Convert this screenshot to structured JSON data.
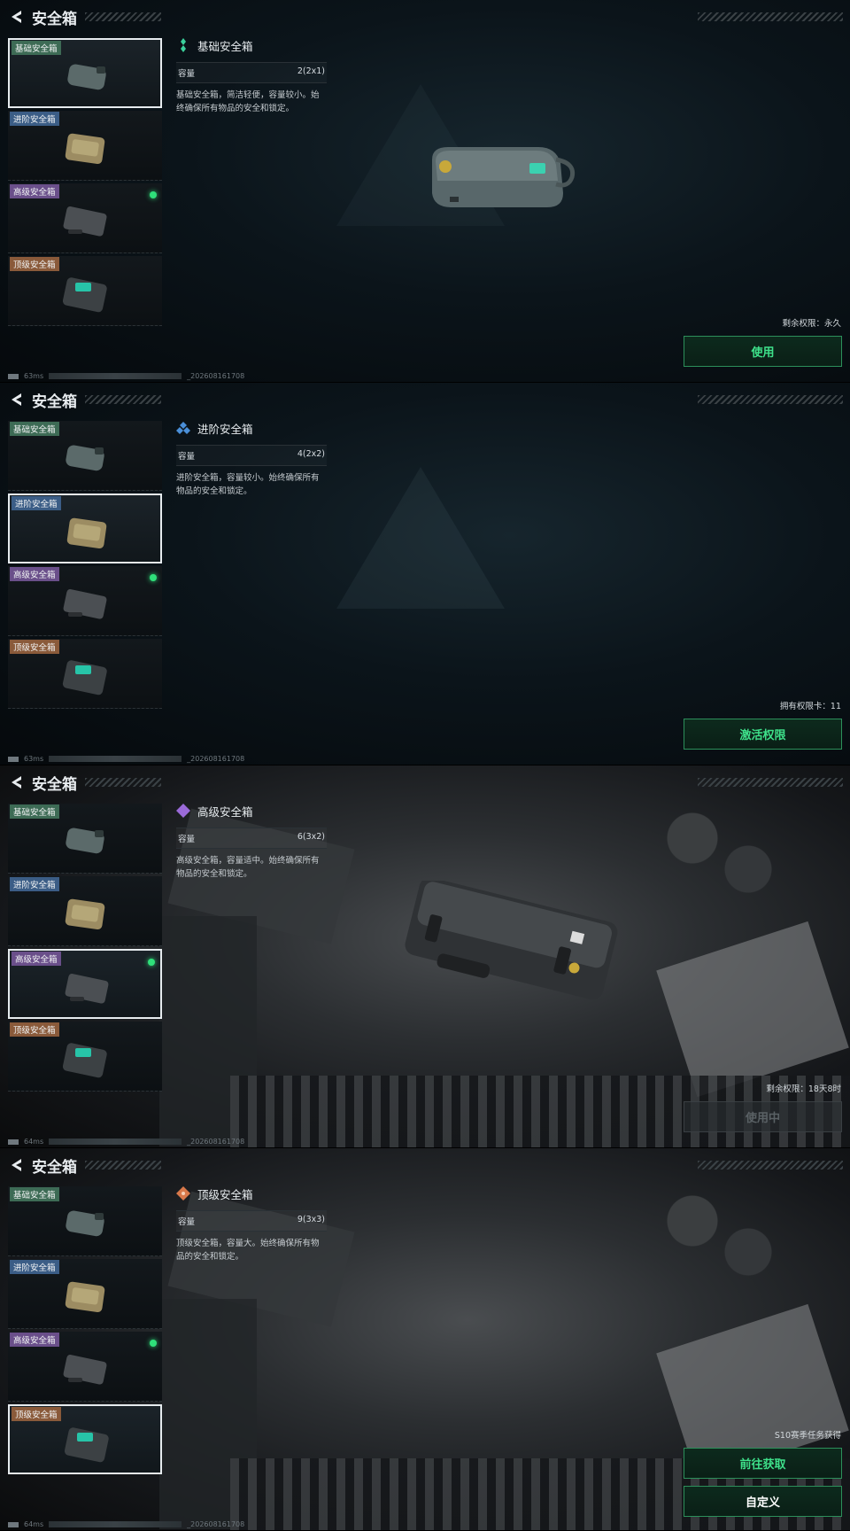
{
  "app_title": "安全箱",
  "boxes": [
    {
      "tag": "基础安全箱",
      "tag_color": "#3d6b55"
    },
    {
      "tag": "进阶安全箱",
      "tag_color": "#3b5d86"
    },
    {
      "tag": "高级安全箱",
      "tag_color": "#6a4f8a"
    },
    {
      "tag": "顶级安全箱",
      "tag_color": "#8a5a3a"
    }
  ],
  "screens": [
    {
      "name": "基础安全箱",
      "gem_color": "#3bd19c",
      "capacity_label": "容量",
      "capacity_value": "2(2x1)",
      "desc": "基础安全箱，简洁轻便，容量较小。始终确保所有物品的安全和锁定。",
      "status": "剩余权限：永久",
      "primary_button": "使用",
      "ping": "63ms",
      "build": "_202608161708"
    },
    {
      "name": "进阶安全箱",
      "gem_color": "#4a8fd8",
      "capacity_label": "容量",
      "capacity_value": "4(2x2)",
      "desc": "进阶安全箱，容量较小。始终确保所有物品的安全和锁定。",
      "status": "拥有权限卡：11",
      "primary_button": "激活权限",
      "ping": "63ms",
      "build": "_202608161708"
    },
    {
      "name": "高级安全箱",
      "gem_color": "#9a6ad8",
      "capacity_label": "容量",
      "capacity_value": "6(3x2)",
      "desc": "高级安全箱，容量适中。始终确保所有物品的安全和锁定。",
      "status": "剩余权限：18天8时",
      "primary_button": "使用中",
      "ping": "64ms",
      "build": "_202608161708"
    },
    {
      "name": "顶级安全箱",
      "gem_color": "#d8784a",
      "capacity_label": "容量",
      "capacity_value": "9(3x3)",
      "desc": "顶级安全箱，容量大。始终确保所有物品的安全和锁定。",
      "status": "S10赛季任务获得",
      "primary_button": "前往获取",
      "secondary_button": "自定义",
      "ping": "64ms",
      "build": "_202608161708"
    }
  ]
}
